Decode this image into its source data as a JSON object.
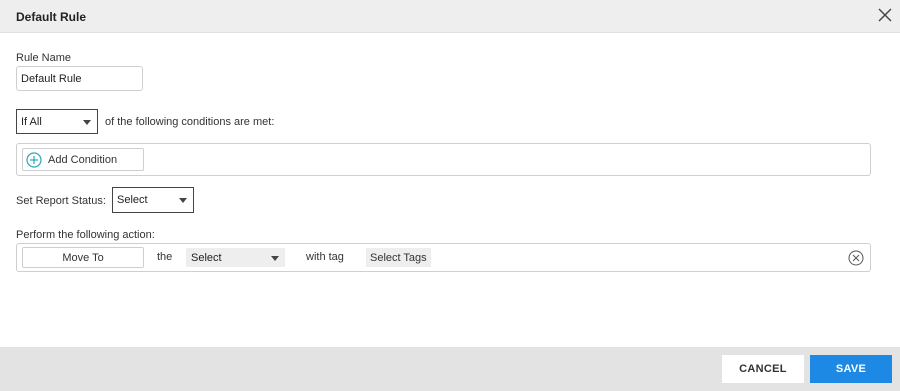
{
  "dialog": {
    "title": "Default Rule",
    "close_icon": "close-icon"
  },
  "rule_name": {
    "label": "Rule Name",
    "value": "Default Rule"
  },
  "conditions": {
    "match_select_value": "If All",
    "suffix_text": "of the following conditions are met:",
    "add_condition_label": "Add Condition",
    "add_icon": "plus-circle-icon"
  },
  "report_status": {
    "label": "Set Report Status:",
    "select_value": "Select"
  },
  "action": {
    "label": "Perform the following action:",
    "move_button_label": "Move To",
    "the_text": "the",
    "target_select_value": "Select",
    "with_tag_text": "with tag",
    "tags_placeholder": "Select Tags",
    "remove_icon": "remove-circle-icon"
  },
  "footer": {
    "cancel_label": "CANCEL",
    "save_label": "SAVE"
  },
  "colors": {
    "accent": "#1e88e5",
    "add_icon": "#2aa7b8",
    "header_bg": "#eeeeee",
    "footer_bg": "#e3e3e3"
  }
}
